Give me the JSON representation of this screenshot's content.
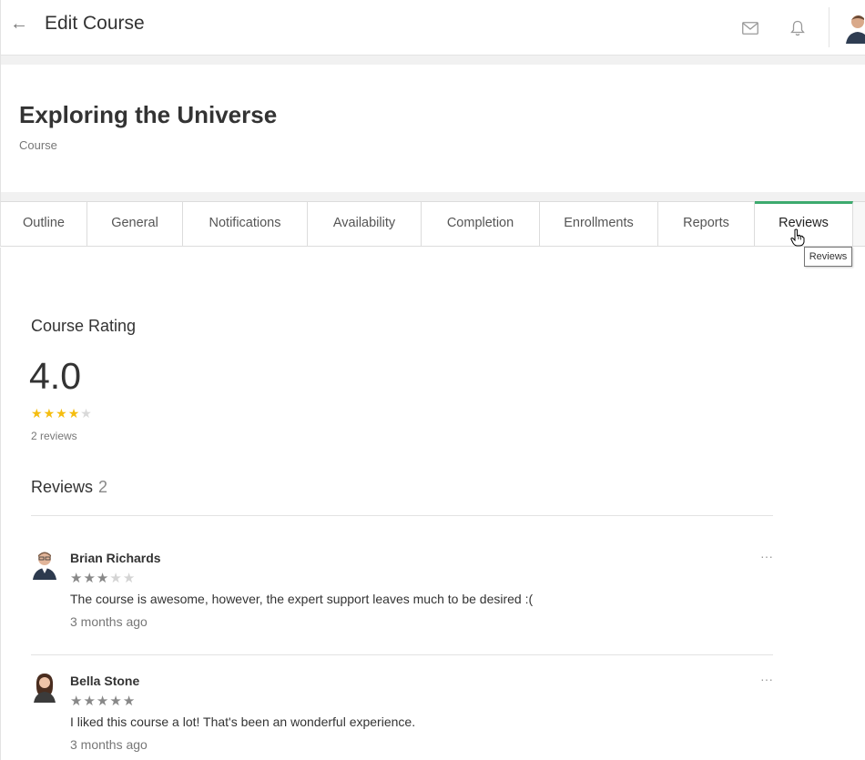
{
  "header": {
    "title": "Edit Course",
    "back_icon": "arrow-left-icon",
    "mail_icon": "mail-icon",
    "bell_icon": "bell-icon"
  },
  "course": {
    "title": "Exploring the Universe",
    "type": "Course"
  },
  "tabs": [
    {
      "label": "Outline"
    },
    {
      "label": "General"
    },
    {
      "label": "Notifications"
    },
    {
      "label": "Availability"
    },
    {
      "label": "Completion"
    },
    {
      "label": "Enrollments"
    },
    {
      "label": "Reports"
    },
    {
      "label": "Reviews",
      "active": true
    }
  ],
  "tooltip": "Reviews",
  "rating": {
    "heading": "Course Rating",
    "value": "4.0",
    "stars": 4,
    "max_stars": 5,
    "count_text": "2 reviews"
  },
  "reviews_section": {
    "heading": "Reviews",
    "count": "2"
  },
  "reviews": [
    {
      "name": "Brian Richards",
      "stars": 3,
      "text": "The course is awesome, however, the expert support leaves much to be desired :(",
      "time": "3 months ago",
      "menu": "···"
    },
    {
      "name": "Bella Stone",
      "stars": 5,
      "text": "I liked this course a lot! That's been an wonderful experience.",
      "time": "3 months ago",
      "menu": "···"
    }
  ],
  "colors": {
    "accent": "#3daa6e",
    "star": "#f5bd0f"
  }
}
